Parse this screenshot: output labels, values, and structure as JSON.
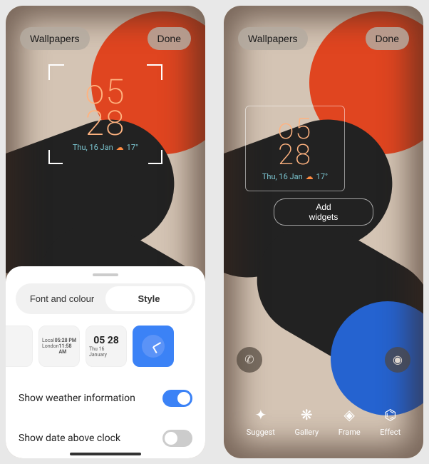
{
  "topbar": {
    "wallpapers_label": "Wallpapers",
    "done_label": "Done"
  },
  "clock": {
    "time_line1": "o5",
    "time_line2": "28",
    "date": "Thu, 16 Jan",
    "temp": "17°"
  },
  "right_panel": {
    "add_widgets_label": "Add widgets",
    "nav": [
      {
        "icon": "✦",
        "label": "Suggest"
      },
      {
        "icon": "❋",
        "label": "Gallery"
      },
      {
        "icon": "◈",
        "label": "Frame"
      },
      {
        "icon": "⌬",
        "label": "Effect"
      }
    ]
  },
  "sheet": {
    "tabs": {
      "font_colour_label": "Font and colour",
      "style_label": "Style"
    },
    "style_tiles": [
      {
        "line1": "",
        "line2": ""
      },
      {
        "line1": "Local",
        "time1": "05:28 PM",
        "line2": "London",
        "time2": "11:58 AM"
      },
      {
        "main": "05 28",
        "sub": "Thu 16 January"
      },
      {
        "type": "analog"
      }
    ],
    "settings": {
      "weather_label": "Show weather information",
      "weather_on": true,
      "date_above_label": "Show date above clock",
      "date_above_on": false
    }
  }
}
